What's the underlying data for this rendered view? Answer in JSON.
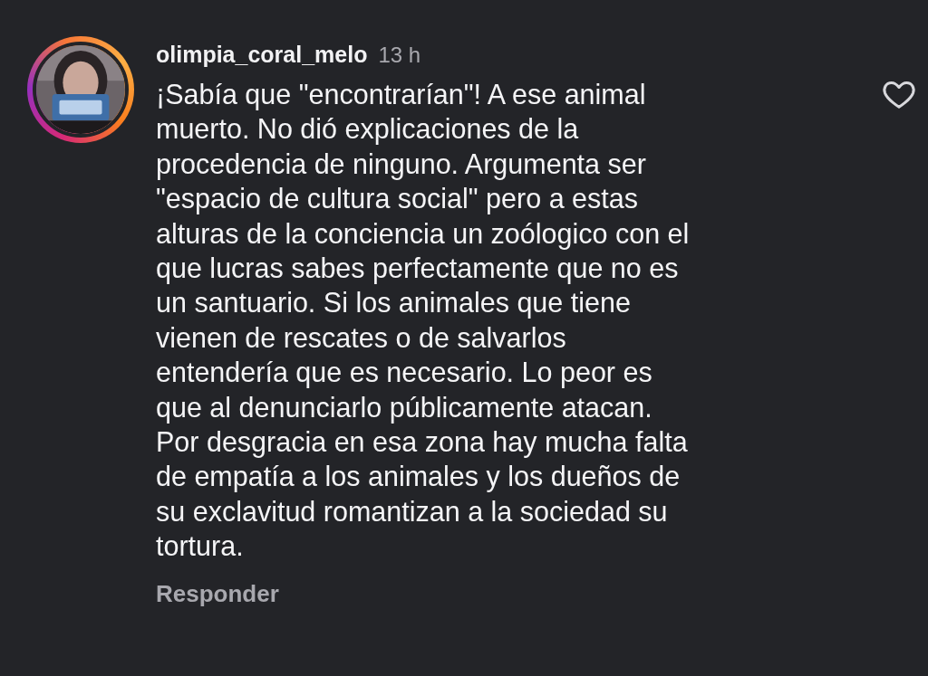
{
  "comment": {
    "avatar": {
      "kind": "picture",
      "story_ring": true
    },
    "username": "olimpia_coral_melo",
    "time": "13 h",
    "text_lines": [
      "¡Sabía que \"encontrarían\"! A ese animal",
      "muerto. No dió explicaciones de la",
      "procedencia de ninguno. Argumenta ser",
      "\"espacio de cultura social\" pero a estas",
      "alturas de la conciencia un zoólogico con el",
      "que lucras sabes perfectamente que no es",
      "un santuario. Si los animales que tiene",
      "vienen de rescates o de salvarlos",
      "entendería que es necesario. Lo peor es",
      "que al denunciarlo públicamente atacan.",
      "Por desgracia en esa zona hay mucha falta",
      "de empatía a los animales y los dueños de",
      "su exclavitud romantizan a la sociedad su",
      "tortura."
    ],
    "liked": false,
    "reply_label": "Responder"
  }
}
